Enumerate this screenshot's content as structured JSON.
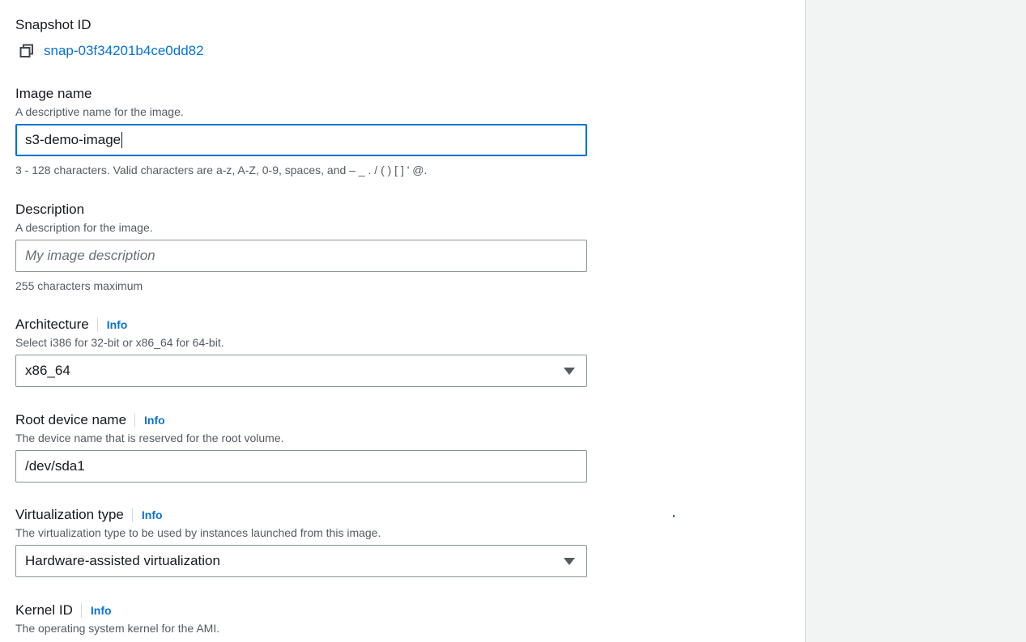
{
  "snapshot": {
    "label": "Snapshot ID",
    "value": "snap-03f34201b4ce0dd82",
    "icon": "copy-icon"
  },
  "image_name": {
    "label": "Image name",
    "description": "A descriptive name for the image.",
    "value": "s3-demo-image",
    "constraint": "3 - 128 characters. Valid characters are a-z, A-Z, 0-9, spaces, and – _ . / ( ) [ ] ' @."
  },
  "description": {
    "label": "Description",
    "description": "A description for the image.",
    "placeholder": "My image description",
    "constraint": "255 characters maximum"
  },
  "architecture": {
    "label": "Architecture",
    "info": "Info",
    "description": "Select i386 for 32-bit or x86_64 for 64-bit.",
    "selected": "x86_64"
  },
  "root_device": {
    "label": "Root device name",
    "info": "Info",
    "description": "The device name that is reserved for the root volume.",
    "value": "/dev/sda1"
  },
  "virtualization": {
    "label": "Virtualization type",
    "info": "Info",
    "description": "The virtualization type to be used by instances launched from this image.",
    "selected": "Hardware-assisted virtualization"
  },
  "kernel": {
    "label": "Kernel ID",
    "info": "Info",
    "description": "The operating system kernel for the AMI."
  },
  "colors": {
    "link": "#0972d3",
    "focus_border": "#0972d3",
    "side_panel": "#f2f3f3"
  }
}
